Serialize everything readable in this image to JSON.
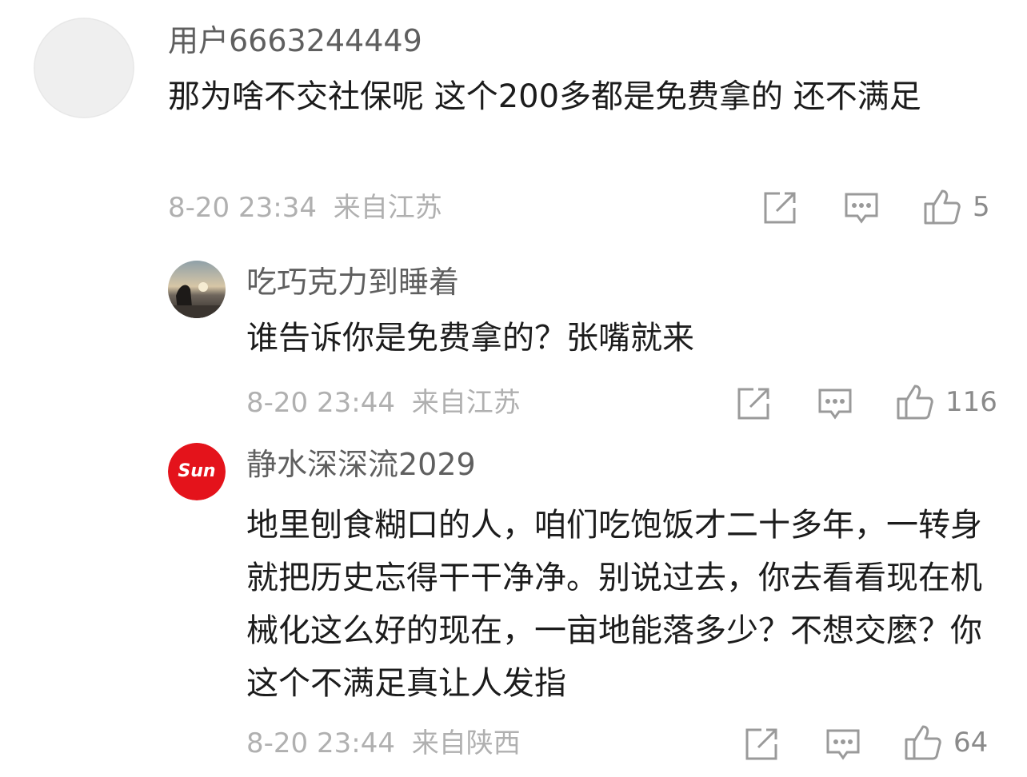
{
  "comments": [
    {
      "username": "用户6663244449",
      "content": "那为啥不交社保呢 这个200多都是免费拿的 还不满足",
      "time": "8-20 23:34",
      "location": "来自江苏",
      "likes": "5",
      "avatar_icon": "default-avatar-icon"
    },
    {
      "username": "吃巧克力到睡着",
      "content": "谁告诉你是免费拿的？张嘴就来",
      "time": "8-20 23:44",
      "location": "来自江苏",
      "likes": "116",
      "avatar_icon": "sunset-photo-avatar"
    },
    {
      "username": "静水深深流2029",
      "content": "地里刨食糊口的人，咱们吃饱饭才二十多年，一转身就把历史忘得干干净净。别说过去，你去看看现在机械化这么好的现在，一亩地能落多少？不想交麽？你这个不满足真让人发指",
      "time": "8-20 23:44",
      "location": "来自陕西",
      "likes": "64",
      "avatar_icon": "sun-logo-avatar",
      "avatar_text": "Sun"
    }
  ],
  "colors": {
    "username": "#5f5f5f",
    "content": "#1c1c1c",
    "meta": "#b0b0b0",
    "icon": "#9a9a9a",
    "sun_red": "#e4131b"
  }
}
